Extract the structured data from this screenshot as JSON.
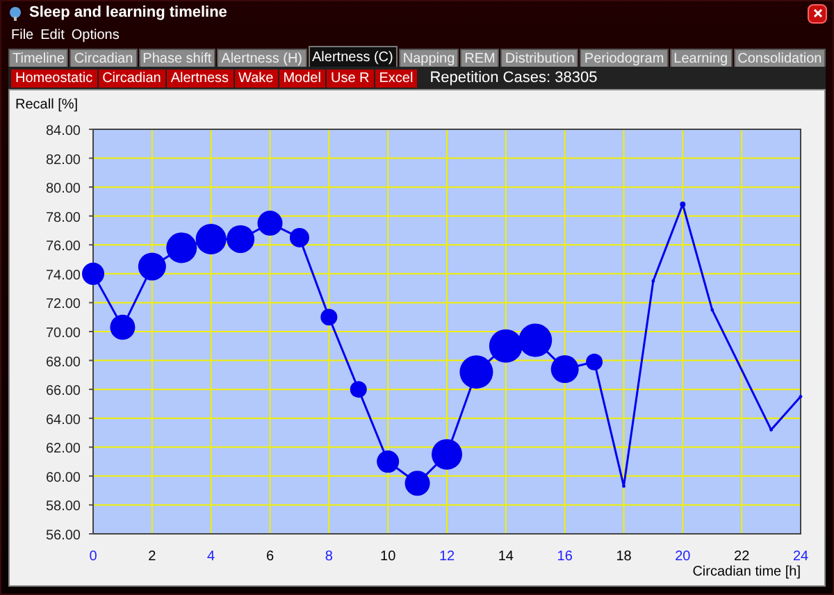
{
  "window": {
    "title": "Sleep and learning timeline"
  },
  "menu": [
    "File",
    "Edit",
    "Options"
  ],
  "tabs": [
    {
      "label": "Timeline",
      "selected": false
    },
    {
      "label": "Circadian",
      "selected": false
    },
    {
      "label": "Phase shift",
      "selected": false
    },
    {
      "label": "Alertness (H)",
      "selected": false
    },
    {
      "label": "Alertness (C)",
      "selected": true
    },
    {
      "label": "Napping",
      "selected": false
    },
    {
      "label": "REM",
      "selected": false
    },
    {
      "label": "Distribution",
      "selected": false
    },
    {
      "label": "Periodogram",
      "selected": false
    },
    {
      "label": "Learning",
      "selected": false
    },
    {
      "label": "Consolidation",
      "selected": false
    }
  ],
  "toolbar": {
    "buttons": [
      "Homeostatic",
      "Circadian",
      "Alertness",
      "Wake",
      "Model",
      "Use R",
      "Excel"
    ],
    "status": "Repetition Cases: 38305"
  },
  "panel": {
    "chart_data": {
      "type": "line",
      "ylabel": "Recall [%]",
      "grid": true,
      "xlabel": "Circadian time [h]",
      "x": [
        0,
        1,
        2,
        3,
        4,
        5,
        6,
        7,
        8,
        9,
        10,
        11,
        12,
        13,
        14,
        15,
        16,
        17,
        18,
        19,
        20,
        21,
        23,
        24
      ],
      "series": [
        {
          "color": "#0000ee",
          "values": [
            74.0,
            70.3,
            74.5,
            75.8,
            76.4,
            76.4,
            77.5,
            76.5,
            71.0,
            66.0,
            61.0,
            59.5,
            61.5,
            67.2,
            69.0,
            69.4,
            67.4,
            67.9,
            59.3,
            73.5,
            78.8,
            71.5,
            63.2,
            65.5
          ]
        }
      ],
      "xlim": [
        0,
        24
      ],
      "ylim": [
        56,
        84
      ],
      "xticks": [
        0,
        2,
        4,
        6,
        8,
        10,
        12,
        14,
        16,
        18,
        20,
        22,
        24
      ],
      "yticks": [
        {
          "value": 56,
          "label": "56.00"
        },
        {
          "value": 58,
          "label": "58.00"
        },
        {
          "value": 60,
          "label": "60.00"
        },
        {
          "value": 62,
          "label": "62.00"
        },
        {
          "value": 64,
          "label": "64.00"
        },
        {
          "value": 66,
          "label": "66.00"
        },
        {
          "value": 68,
          "label": "68.00"
        },
        {
          "value": 70,
          "label": "70.00"
        },
        {
          "value": 72,
          "label": "72.00"
        },
        {
          "value": 74,
          "label": "74.00"
        },
        {
          "value": 76,
          "label": "76.00"
        },
        {
          "value": 78,
          "label": "78.00"
        },
        {
          "value": 80,
          "label": "80.00"
        },
        {
          "value": 82,
          "label": "82.00"
        },
        {
          "value": 84,
          "label": "84.00"
        }
      ]
    }
  }
}
